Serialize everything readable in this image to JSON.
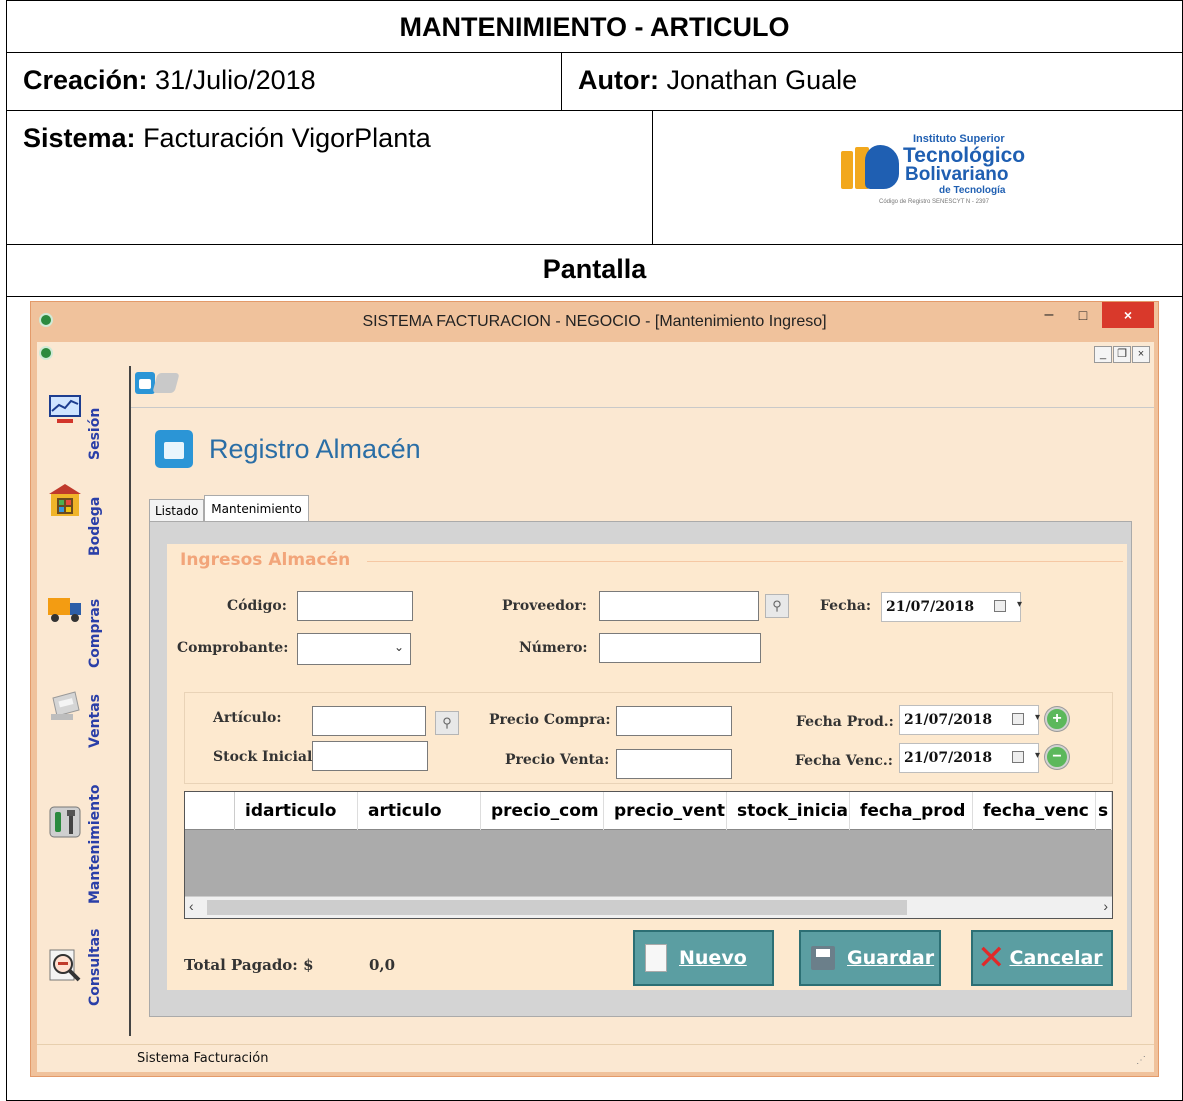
{
  "doc": {
    "title": "MANTENIMIENTO - ARTICULO",
    "creacion_label": "Creación:",
    "creacion_value": " 31/Julio/2018",
    "autor_label": "Autor:",
    "autor_value": " Jonathan Guale",
    "sistema_label": "Sistema:",
    "sistema_value": " Facturación VigorPlanta",
    "pantalla": "Pantalla",
    "logo": {
      "line1": "Instituto Superior",
      "line2": "Tecnológico",
      "line3": "Bolivariano",
      "line4": "de Tecnología",
      "line5": "Código de Registro SENESCYT N - 2397"
    }
  },
  "window": {
    "title": "SISTEMA FACTURACION - NEGOCIO - [Mantenimiento Ingreso]",
    "close_label": "×"
  },
  "sidebar": [
    {
      "label": "Sesión",
      "icon": "chart-monitor-icon"
    },
    {
      "label": "Bodega",
      "icon": "warehouse-icon"
    },
    {
      "label": "Compras",
      "icon": "truck-icon"
    },
    {
      "label": "Ventas",
      "icon": "cash-register-icon"
    },
    {
      "label": "Mantenimiento",
      "icon": "tools-icon"
    },
    {
      "label": "Consultas",
      "icon": "magnifier-icon"
    }
  ],
  "form": {
    "title": "Registro Almacén",
    "tabs": [
      "Listado",
      "Mantenimiento"
    ],
    "group_title": "Ingresos Almacén",
    "fields": {
      "codigo": "Código:",
      "proveedor": "Proveedor:",
      "fecha": "Fecha:",
      "comprobante": "Comprobante:",
      "numero": "Número:",
      "articulo": "Artículo:",
      "stock_inicial": "Stock Inicial:",
      "precio_compra": "Precio Compra:",
      "precio_venta": "Precio Venta:",
      "fecha_prod": "Fecha Prod.:",
      "fecha_venc": "Fecha Venc.:"
    },
    "dates": {
      "fecha": "21/07/2018",
      "fecha_prod": "21/07/2018",
      "fecha_venc": "21/07/2018"
    },
    "grid_columns": [
      "idarticulo",
      "articulo",
      "precio_com",
      "precio_vent",
      "stock_inicia",
      "fecha_prod",
      "fecha_venc",
      "s"
    ],
    "total_label": "Total Pagado:  $",
    "total_value": "0,0",
    "buttons": {
      "nuevo": "Nuevo",
      "guardar": "Guardar",
      "cancelar": "Cancelar"
    }
  },
  "status": {
    "text": "Sistema Facturación"
  },
  "colors": {
    "window_frame": "#f0c29c",
    "client_bg": "#fbe8d2",
    "button_bg": "#5b9ea2",
    "sidebar_text": "#2a3fa8",
    "close_red": "#d9392b"
  }
}
